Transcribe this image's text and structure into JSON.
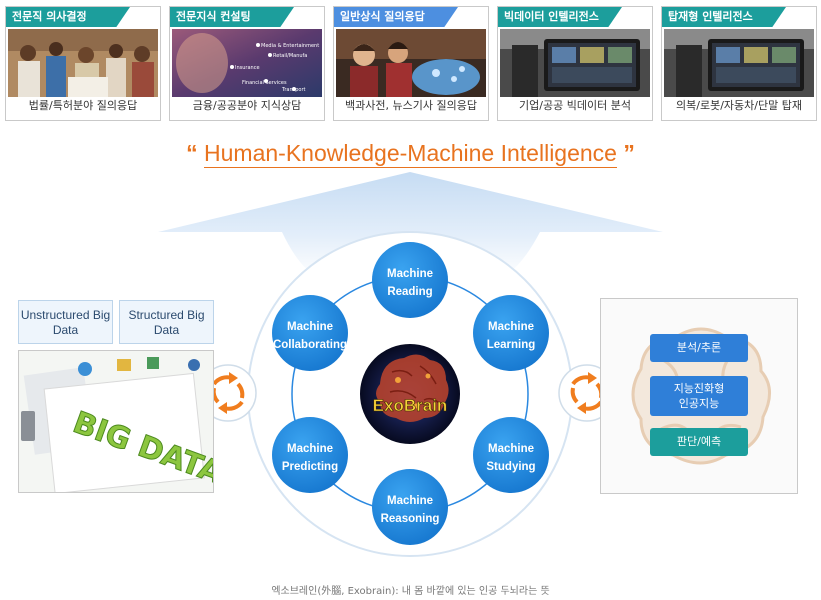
{
  "cards": [
    {
      "tag": "전문직 의사결정",
      "caption": "법률/특허분야 질의응답",
      "color": "#1c9e9c"
    },
    {
      "tag": "전문지식 컨설팅",
      "caption": "금융/공공분야 지식상담",
      "color": "#1c9e9c"
    },
    {
      "tag": "일반상식 질의응답",
      "caption": "백과사전, 뉴스기사 질의응답",
      "color": "#4d8fe0"
    },
    {
      "tag": "빅데이터 인텔리전스",
      "caption": "기업/공공 빅데이터 분석",
      "color": "#1c9e9c"
    },
    {
      "tag": "탑재형 인텔리전스",
      "caption": "의복/로봇/자동차/단말 탑재",
      "color": "#1c9e9c"
    }
  ],
  "card2_photo_text": [
    "Media & Entertainment",
    "Retail/Manufa",
    "Insurance",
    "Financial Services",
    "Transport"
  ],
  "tagline": {
    "open_quote": "“",
    "text": "Human-Knowledge-Machine Intelligence",
    "close_quote": "”"
  },
  "left_panel": {
    "unstructured": "Unstructured Big Data",
    "structured": "Structured Big Data",
    "art_text": "BIG DATA"
  },
  "center": {
    "core_label": "ExoBrain",
    "nodes": [
      {
        "line1": "Machine",
        "line2": "Reading"
      },
      {
        "line1": "Machine",
        "line2": "Learning"
      },
      {
        "line1": "Machine",
        "line2": "Studying"
      },
      {
        "line1": "Machine",
        "line2": "Reasoning"
      },
      {
        "line1": "Machine",
        "line2": "Predicting"
      },
      {
        "line1": "Machine",
        "line2": "Collaborating"
      }
    ]
  },
  "right_panel": {
    "btn1": "분석/추론",
    "btn2_line1": "지능진화형",
    "btn2_line2": "인공지능",
    "btn3": "판단/예측"
  },
  "colors": {
    "node_blue": "#1e8be0",
    "teal": "#1c9e9c",
    "btn_blue": "#2f7fd8",
    "arrow_orange": "#f07d1e",
    "tagline_orange": "#e8731f"
  },
  "footer": "엑소브레인(外腦, Exobrain): 내 몸 바깥에 있는 인공 두뇌라는 뜻"
}
